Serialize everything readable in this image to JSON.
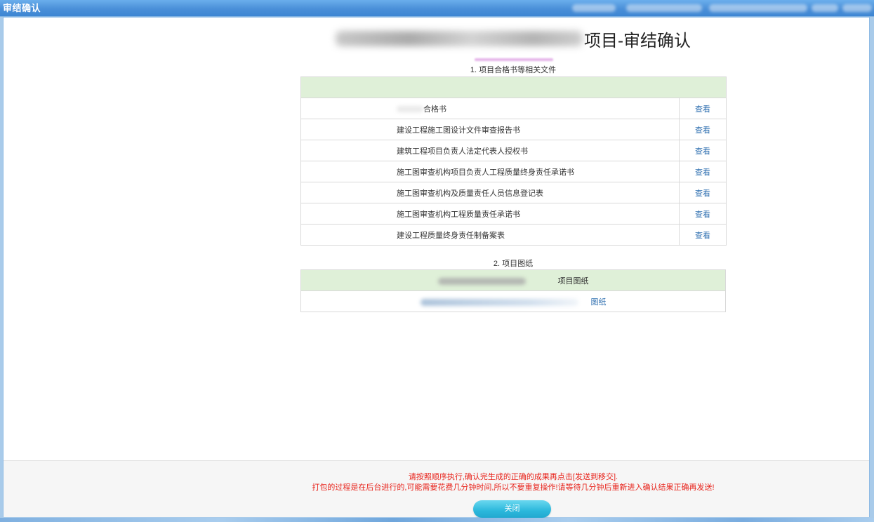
{
  "window": {
    "title": "审结确认"
  },
  "header": {
    "title_suffix": "项目-审结确认"
  },
  "sections": {
    "documents_heading": "1. 项目合格书等相关文件",
    "drawings_heading": "2. 项目图纸"
  },
  "documents": [
    {
      "name": "合格书",
      "action": "查看"
    },
    {
      "name": "建设工程施工图设计文件审查报告书",
      "action": "查看"
    },
    {
      "name": "建筑工程项目负责人法定代表人授权书",
      "action": "查看"
    },
    {
      "name": "施工图审查机构项目负责人工程质量终身责任承诺书",
      "action": "查看"
    },
    {
      "name": "施工图审查机构及质量责任人员信息登记表",
      "action": "查看"
    },
    {
      "name": "施工图审查机构工程质量责任承诺书",
      "action": "查看"
    },
    {
      "name": "建设工程质量终身责任制备案表",
      "action": "查看"
    }
  ],
  "drawings": {
    "header_label": "项目图纸",
    "link_label": "图纸"
  },
  "footer": {
    "notice_line1": "请按照顺序执行,确认完生成的正确的成果再点击[发送到移交].",
    "notice_line2": "打包的过程是在后台进行的,可能需要花费几分钟时间,所以不要重复操作!请等待几分钟后重新进入确认结果正确再发送!",
    "close_label": "关闭"
  },
  "colors": {
    "titlebar": "#4a8fd8",
    "table_header": "#dff0d8",
    "link": "#2f6fb0",
    "notice": "#e8231b",
    "button": "#2cb8dc"
  }
}
